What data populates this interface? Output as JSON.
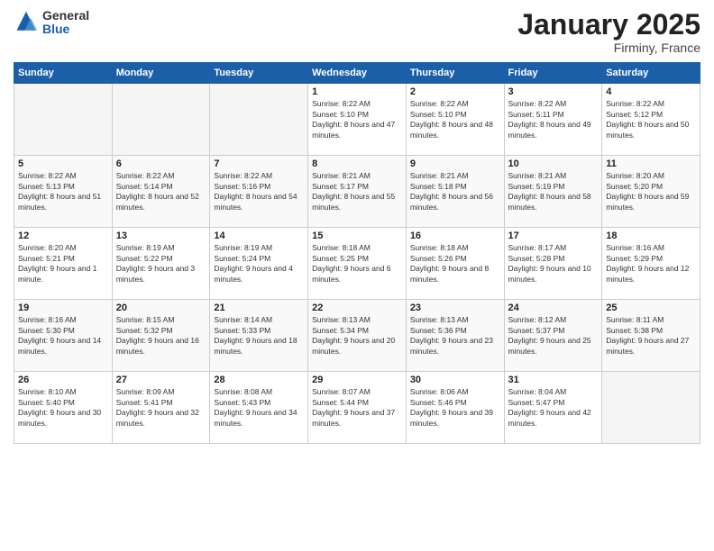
{
  "logo": {
    "general": "General",
    "blue": "Blue"
  },
  "header": {
    "month": "January 2025",
    "location": "Firminy, France"
  },
  "weekdays": [
    "Sunday",
    "Monday",
    "Tuesday",
    "Wednesday",
    "Thursday",
    "Friday",
    "Saturday"
  ],
  "weeks": [
    [
      {
        "day": "",
        "info": ""
      },
      {
        "day": "",
        "info": ""
      },
      {
        "day": "",
        "info": ""
      },
      {
        "day": "1",
        "info": "Sunrise: 8:22 AM\nSunset: 5:10 PM\nDaylight: 8 hours and 47 minutes."
      },
      {
        "day": "2",
        "info": "Sunrise: 8:22 AM\nSunset: 5:10 PM\nDaylight: 8 hours and 48 minutes."
      },
      {
        "day": "3",
        "info": "Sunrise: 8:22 AM\nSunset: 5:11 PM\nDaylight: 8 hours and 49 minutes."
      },
      {
        "day": "4",
        "info": "Sunrise: 8:22 AM\nSunset: 5:12 PM\nDaylight: 8 hours and 50 minutes."
      }
    ],
    [
      {
        "day": "5",
        "info": "Sunrise: 8:22 AM\nSunset: 5:13 PM\nDaylight: 8 hours and 51 minutes."
      },
      {
        "day": "6",
        "info": "Sunrise: 8:22 AM\nSunset: 5:14 PM\nDaylight: 8 hours and 52 minutes."
      },
      {
        "day": "7",
        "info": "Sunrise: 8:22 AM\nSunset: 5:16 PM\nDaylight: 8 hours and 54 minutes."
      },
      {
        "day": "8",
        "info": "Sunrise: 8:21 AM\nSunset: 5:17 PM\nDaylight: 8 hours and 55 minutes."
      },
      {
        "day": "9",
        "info": "Sunrise: 8:21 AM\nSunset: 5:18 PM\nDaylight: 8 hours and 56 minutes."
      },
      {
        "day": "10",
        "info": "Sunrise: 8:21 AM\nSunset: 5:19 PM\nDaylight: 8 hours and 58 minutes."
      },
      {
        "day": "11",
        "info": "Sunrise: 8:20 AM\nSunset: 5:20 PM\nDaylight: 8 hours and 59 minutes."
      }
    ],
    [
      {
        "day": "12",
        "info": "Sunrise: 8:20 AM\nSunset: 5:21 PM\nDaylight: 9 hours and 1 minute."
      },
      {
        "day": "13",
        "info": "Sunrise: 8:19 AM\nSunset: 5:22 PM\nDaylight: 9 hours and 3 minutes."
      },
      {
        "day": "14",
        "info": "Sunrise: 8:19 AM\nSunset: 5:24 PM\nDaylight: 9 hours and 4 minutes."
      },
      {
        "day": "15",
        "info": "Sunrise: 8:18 AM\nSunset: 5:25 PM\nDaylight: 9 hours and 6 minutes."
      },
      {
        "day": "16",
        "info": "Sunrise: 8:18 AM\nSunset: 5:26 PM\nDaylight: 9 hours and 8 minutes."
      },
      {
        "day": "17",
        "info": "Sunrise: 8:17 AM\nSunset: 5:28 PM\nDaylight: 9 hours and 10 minutes."
      },
      {
        "day": "18",
        "info": "Sunrise: 8:16 AM\nSunset: 5:29 PM\nDaylight: 9 hours and 12 minutes."
      }
    ],
    [
      {
        "day": "19",
        "info": "Sunrise: 8:16 AM\nSunset: 5:30 PM\nDaylight: 9 hours and 14 minutes."
      },
      {
        "day": "20",
        "info": "Sunrise: 8:15 AM\nSunset: 5:32 PM\nDaylight: 9 hours and 16 minutes."
      },
      {
        "day": "21",
        "info": "Sunrise: 8:14 AM\nSunset: 5:33 PM\nDaylight: 9 hours and 18 minutes."
      },
      {
        "day": "22",
        "info": "Sunrise: 8:13 AM\nSunset: 5:34 PM\nDaylight: 9 hours and 20 minutes."
      },
      {
        "day": "23",
        "info": "Sunrise: 8:13 AM\nSunset: 5:36 PM\nDaylight: 9 hours and 23 minutes."
      },
      {
        "day": "24",
        "info": "Sunrise: 8:12 AM\nSunset: 5:37 PM\nDaylight: 9 hours and 25 minutes."
      },
      {
        "day": "25",
        "info": "Sunrise: 8:11 AM\nSunset: 5:38 PM\nDaylight: 9 hours and 27 minutes."
      }
    ],
    [
      {
        "day": "26",
        "info": "Sunrise: 8:10 AM\nSunset: 5:40 PM\nDaylight: 9 hours and 30 minutes."
      },
      {
        "day": "27",
        "info": "Sunrise: 8:09 AM\nSunset: 5:41 PM\nDaylight: 9 hours and 32 minutes."
      },
      {
        "day": "28",
        "info": "Sunrise: 8:08 AM\nSunset: 5:43 PM\nDaylight: 9 hours and 34 minutes."
      },
      {
        "day": "29",
        "info": "Sunrise: 8:07 AM\nSunset: 5:44 PM\nDaylight: 9 hours and 37 minutes."
      },
      {
        "day": "30",
        "info": "Sunrise: 8:06 AM\nSunset: 5:46 PM\nDaylight: 9 hours and 39 minutes."
      },
      {
        "day": "31",
        "info": "Sunrise: 8:04 AM\nSunset: 5:47 PM\nDaylight: 9 hours and 42 minutes."
      },
      {
        "day": "",
        "info": ""
      }
    ]
  ]
}
